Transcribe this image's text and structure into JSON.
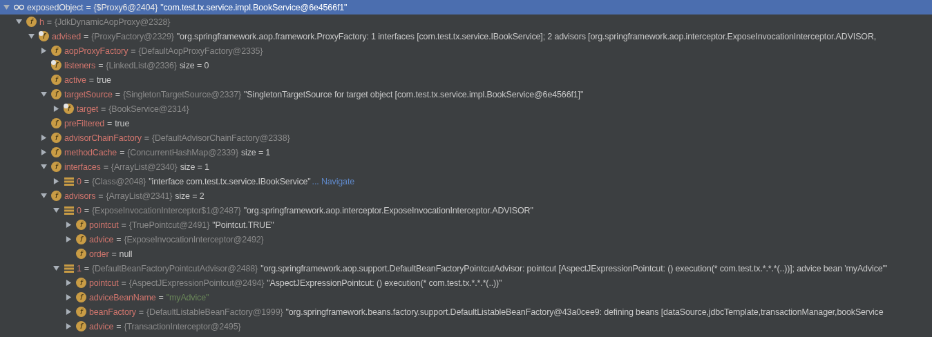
{
  "tree": [
    {
      "kind": "watch",
      "name": "exposedObject",
      "eq": "=",
      "type": "{$Proxy6@2404}",
      "value": "\"com.test.tx.service.impl.BookService@6e4566f1\"",
      "literal": false,
      "selected": true,
      "expanded": true,
      "children": [
        {
          "kind": "field",
          "icon_letter": "f",
          "name": "h",
          "eq": "=",
          "type": "{JdkDynamicAopProxy@2328}",
          "selected": false,
          "expanded": true,
          "marked": false,
          "children": [
            {
              "kind": "field",
              "icon_letter": "f",
              "name": "advised",
              "eq": "=",
              "type": "{ProxyFactory@2329}",
              "value": "\"org.springframework.aop.framework.ProxyFactory: 1 interfaces [com.test.tx.service.IBookService]; 2 advisors [org.springframework.aop.interceptor.ExposeInvocationInterceptor.ADVISOR,",
              "literal": false,
              "selected": false,
              "expanded": true,
              "marked": true,
              "children": [
                {
                  "kind": "field",
                  "icon_letter": "f",
                  "name": "aopProxyFactory",
                  "eq": "=",
                  "type": "{DefaultAopProxyFactory@2335}",
                  "selected": false,
                  "expanded": false,
                  "marked": false
                },
                {
                  "kind": "field",
                  "icon_letter": "f",
                  "name": "listeners",
                  "eq": "=",
                  "type": "{LinkedList@2336}",
                  "value": "size = 0",
                  "literal": false,
                  "selected": false,
                  "marked": true
                },
                {
                  "kind": "field",
                  "icon_letter": "f",
                  "name": "active",
                  "eq": "=",
                  "value": "true",
                  "literal": false,
                  "selected": false,
                  "marked": false
                },
                {
                  "kind": "field",
                  "icon_letter": "f",
                  "name": "targetSource",
                  "eq": "=",
                  "type": "{SingletonTargetSource@2337}",
                  "value": "\"SingletonTargetSource for target object [com.test.tx.service.impl.BookService@6e4566f1]\"",
                  "literal": false,
                  "selected": false,
                  "expanded": true,
                  "marked": false,
                  "children": [
                    {
                      "kind": "field",
                      "icon_letter": "f",
                      "name": "target",
                      "eq": "=",
                      "type": "{BookService@2314}",
                      "selected": false,
                      "expanded": false,
                      "marked": true
                    }
                  ]
                },
                {
                  "kind": "field",
                  "icon_letter": "f",
                  "name": "preFiltered",
                  "eq": "=",
                  "value": "true",
                  "literal": false,
                  "selected": false,
                  "marked": false
                },
                {
                  "kind": "field",
                  "icon_letter": "f",
                  "name": "advisorChainFactory",
                  "eq": "=",
                  "type": "{DefaultAdvisorChainFactory@2338}",
                  "selected": false,
                  "expanded": false,
                  "marked": false
                },
                {
                  "kind": "field",
                  "icon_letter": "f",
                  "name": "methodCache",
                  "eq": "=",
                  "type": "{ConcurrentHashMap@2339}",
                  "value": "size = 1",
                  "literal": false,
                  "selected": false,
                  "expanded": false,
                  "marked": false
                },
                {
                  "kind": "field",
                  "icon_letter": "f",
                  "name": "interfaces",
                  "eq": "=",
                  "type": "{ArrayList@2340}",
                  "value": "size = 1",
                  "literal": false,
                  "selected": false,
                  "expanded": true,
                  "marked": false,
                  "children": [
                    {
                      "kind": "element",
                      "name": "0",
                      "eq": "=",
                      "type": "{Class@2048}",
                      "value": "\"interface com.test.tx.service.IBookService\"",
                      "literal": false,
                      "link": "... Navigate",
                      "selected": false,
                      "expanded": false
                    }
                  ]
                },
                {
                  "kind": "field",
                  "icon_letter": "f",
                  "name": "advisors",
                  "eq": "=",
                  "type": "{ArrayList@2341}",
                  "value": "size = 2",
                  "literal": false,
                  "selected": false,
                  "expanded": true,
                  "marked": false,
                  "children": [
                    {
                      "kind": "element",
                      "name": "0",
                      "eq": "=",
                      "type": "{ExposeInvocationInterceptor$1@2487}",
                      "value": "\"org.springframework.aop.interceptor.ExposeInvocationInterceptor.ADVISOR\"",
                      "literal": false,
                      "selected": false,
                      "expanded": true,
                      "children": [
                        {
                          "kind": "field",
                          "icon_letter": "f",
                          "name": "pointcut",
                          "eq": "=",
                          "type": "{TruePointcut@2491}",
                          "value": "\"Pointcut.TRUE\"",
                          "literal": false,
                          "selected": false,
                          "expanded": false,
                          "marked": false
                        },
                        {
                          "kind": "field",
                          "icon_letter": "f",
                          "name": "advice",
                          "eq": "=",
                          "type": "{ExposeInvocationInterceptor@2492}",
                          "selected": false,
                          "expanded": false,
                          "marked": false
                        },
                        {
                          "kind": "field",
                          "icon_letter": "f",
                          "name": "order",
                          "eq": "=",
                          "value": "null",
                          "literal": false,
                          "selected": false,
                          "marked": false
                        }
                      ]
                    },
                    {
                      "kind": "element",
                      "name": "1",
                      "eq": "=",
                      "type": "{DefaultBeanFactoryPointcutAdvisor@2488}",
                      "value": "\"org.springframework.aop.support.DefaultBeanFactoryPointcutAdvisor: pointcut [AspectJExpressionPointcut: () execution(* com.test.tx.*.*.*(..))]; advice bean 'myAdvice'\"",
                      "literal": false,
                      "selected": false,
                      "expanded": true,
                      "children": [
                        {
                          "kind": "field",
                          "icon_letter": "f",
                          "name": "pointcut",
                          "eq": "=",
                          "type": "{AspectJExpressionPointcut@2494}",
                          "value": "\"AspectJExpressionPointcut: () execution(* com.test.tx.*.*.*(..))\"",
                          "literal": false,
                          "selected": false,
                          "expanded": false,
                          "marked": false
                        },
                        {
                          "kind": "field",
                          "icon_letter": "f",
                          "name": "adviceBeanName",
                          "eq": "=",
                          "value": "\"myAdvice\"",
                          "literal": true,
                          "selected": false,
                          "expanded": false,
                          "marked": false
                        },
                        {
                          "kind": "field",
                          "icon_letter": "f",
                          "name": "beanFactory",
                          "eq": "=",
                          "type": "{DefaultListableBeanFactory@1999}",
                          "value": "\"org.springframework.beans.factory.support.DefaultListableBeanFactory@43a0cee9: defining beans [dataSource,jdbcTemplate,transactionManager,bookService",
                          "literal": false,
                          "selected": false,
                          "expanded": false,
                          "marked": false
                        },
                        {
                          "kind": "field",
                          "icon_letter": "f",
                          "name": "advice",
                          "eq": "=",
                          "type": "{TransactionInterceptor@2495}",
                          "selected": false,
                          "expanded": false,
                          "marked": false
                        }
                      ]
                    }
                  ]
                }
              ]
            }
          ]
        }
      ]
    }
  ]
}
